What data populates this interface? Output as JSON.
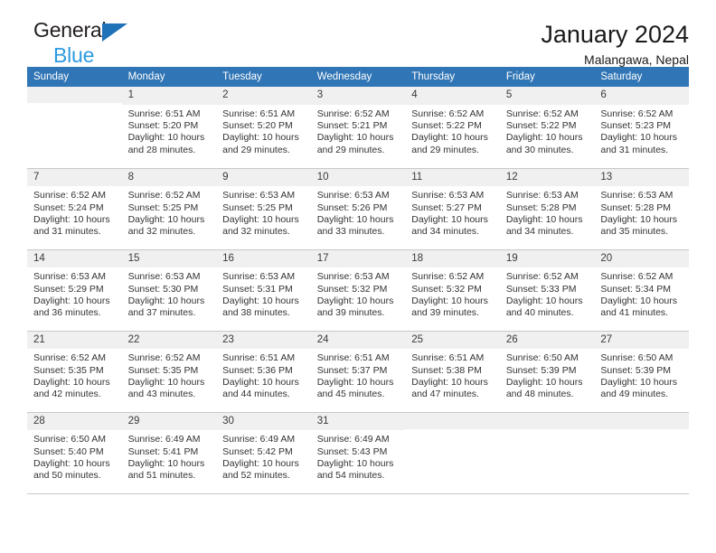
{
  "brand": {
    "name_top": "General",
    "name_bottom": "Blue",
    "triangle_color": "#1f71b8",
    "blue_color": "#2e9ae0"
  },
  "header": {
    "title": "January 2024",
    "location": "Malangawa, Nepal"
  },
  "theme": {
    "header_row_bg": "#3075b5",
    "daynum_bg": "#f0f0f0",
    "grid_line": "#c8c8c8",
    "text": "#333333"
  },
  "weekdays": [
    "Sunday",
    "Monday",
    "Tuesday",
    "Wednesday",
    "Thursday",
    "Friday",
    "Saturday"
  ],
  "weeks": [
    [
      {
        "day": "",
        "sunrise": "",
        "sunset": "",
        "daylight1": "",
        "daylight2": ""
      },
      {
        "day": "1",
        "sunrise": "Sunrise: 6:51 AM",
        "sunset": "Sunset: 5:20 PM",
        "daylight1": "Daylight: 10 hours",
        "daylight2": "and 28 minutes."
      },
      {
        "day": "2",
        "sunrise": "Sunrise: 6:51 AM",
        "sunset": "Sunset: 5:20 PM",
        "daylight1": "Daylight: 10 hours",
        "daylight2": "and 29 minutes."
      },
      {
        "day": "3",
        "sunrise": "Sunrise: 6:52 AM",
        "sunset": "Sunset: 5:21 PM",
        "daylight1": "Daylight: 10 hours",
        "daylight2": "and 29 minutes."
      },
      {
        "day": "4",
        "sunrise": "Sunrise: 6:52 AM",
        "sunset": "Sunset: 5:22 PM",
        "daylight1": "Daylight: 10 hours",
        "daylight2": "and 29 minutes."
      },
      {
        "day": "5",
        "sunrise": "Sunrise: 6:52 AM",
        "sunset": "Sunset: 5:22 PM",
        "daylight1": "Daylight: 10 hours",
        "daylight2": "and 30 minutes."
      },
      {
        "day": "6",
        "sunrise": "Sunrise: 6:52 AM",
        "sunset": "Sunset: 5:23 PM",
        "daylight1": "Daylight: 10 hours",
        "daylight2": "and 31 minutes."
      }
    ],
    [
      {
        "day": "7",
        "sunrise": "Sunrise: 6:52 AM",
        "sunset": "Sunset: 5:24 PM",
        "daylight1": "Daylight: 10 hours",
        "daylight2": "and 31 minutes."
      },
      {
        "day": "8",
        "sunrise": "Sunrise: 6:52 AM",
        "sunset": "Sunset: 5:25 PM",
        "daylight1": "Daylight: 10 hours",
        "daylight2": "and 32 minutes."
      },
      {
        "day": "9",
        "sunrise": "Sunrise: 6:53 AM",
        "sunset": "Sunset: 5:25 PM",
        "daylight1": "Daylight: 10 hours",
        "daylight2": "and 32 minutes."
      },
      {
        "day": "10",
        "sunrise": "Sunrise: 6:53 AM",
        "sunset": "Sunset: 5:26 PM",
        "daylight1": "Daylight: 10 hours",
        "daylight2": "and 33 minutes."
      },
      {
        "day": "11",
        "sunrise": "Sunrise: 6:53 AM",
        "sunset": "Sunset: 5:27 PM",
        "daylight1": "Daylight: 10 hours",
        "daylight2": "and 34 minutes."
      },
      {
        "day": "12",
        "sunrise": "Sunrise: 6:53 AM",
        "sunset": "Sunset: 5:28 PM",
        "daylight1": "Daylight: 10 hours",
        "daylight2": "and 34 minutes."
      },
      {
        "day": "13",
        "sunrise": "Sunrise: 6:53 AM",
        "sunset": "Sunset: 5:28 PM",
        "daylight1": "Daylight: 10 hours",
        "daylight2": "and 35 minutes."
      }
    ],
    [
      {
        "day": "14",
        "sunrise": "Sunrise: 6:53 AM",
        "sunset": "Sunset: 5:29 PM",
        "daylight1": "Daylight: 10 hours",
        "daylight2": "and 36 minutes."
      },
      {
        "day": "15",
        "sunrise": "Sunrise: 6:53 AM",
        "sunset": "Sunset: 5:30 PM",
        "daylight1": "Daylight: 10 hours",
        "daylight2": "and 37 minutes."
      },
      {
        "day": "16",
        "sunrise": "Sunrise: 6:53 AM",
        "sunset": "Sunset: 5:31 PM",
        "daylight1": "Daylight: 10 hours",
        "daylight2": "and 38 minutes."
      },
      {
        "day": "17",
        "sunrise": "Sunrise: 6:53 AM",
        "sunset": "Sunset: 5:32 PM",
        "daylight1": "Daylight: 10 hours",
        "daylight2": "and 39 minutes."
      },
      {
        "day": "18",
        "sunrise": "Sunrise: 6:52 AM",
        "sunset": "Sunset: 5:32 PM",
        "daylight1": "Daylight: 10 hours",
        "daylight2": "and 39 minutes."
      },
      {
        "day": "19",
        "sunrise": "Sunrise: 6:52 AM",
        "sunset": "Sunset: 5:33 PM",
        "daylight1": "Daylight: 10 hours",
        "daylight2": "and 40 minutes."
      },
      {
        "day": "20",
        "sunrise": "Sunrise: 6:52 AM",
        "sunset": "Sunset: 5:34 PM",
        "daylight1": "Daylight: 10 hours",
        "daylight2": "and 41 minutes."
      }
    ],
    [
      {
        "day": "21",
        "sunrise": "Sunrise: 6:52 AM",
        "sunset": "Sunset: 5:35 PM",
        "daylight1": "Daylight: 10 hours",
        "daylight2": "and 42 minutes."
      },
      {
        "day": "22",
        "sunrise": "Sunrise: 6:52 AM",
        "sunset": "Sunset: 5:35 PM",
        "daylight1": "Daylight: 10 hours",
        "daylight2": "and 43 minutes."
      },
      {
        "day": "23",
        "sunrise": "Sunrise: 6:51 AM",
        "sunset": "Sunset: 5:36 PM",
        "daylight1": "Daylight: 10 hours",
        "daylight2": "and 44 minutes."
      },
      {
        "day": "24",
        "sunrise": "Sunrise: 6:51 AM",
        "sunset": "Sunset: 5:37 PM",
        "daylight1": "Daylight: 10 hours",
        "daylight2": "and 45 minutes."
      },
      {
        "day": "25",
        "sunrise": "Sunrise: 6:51 AM",
        "sunset": "Sunset: 5:38 PM",
        "daylight1": "Daylight: 10 hours",
        "daylight2": "and 47 minutes."
      },
      {
        "day": "26",
        "sunrise": "Sunrise: 6:50 AM",
        "sunset": "Sunset: 5:39 PM",
        "daylight1": "Daylight: 10 hours",
        "daylight2": "and 48 minutes."
      },
      {
        "day": "27",
        "sunrise": "Sunrise: 6:50 AM",
        "sunset": "Sunset: 5:39 PM",
        "daylight1": "Daylight: 10 hours",
        "daylight2": "and 49 minutes."
      }
    ],
    [
      {
        "day": "28",
        "sunrise": "Sunrise: 6:50 AM",
        "sunset": "Sunset: 5:40 PM",
        "daylight1": "Daylight: 10 hours",
        "daylight2": "and 50 minutes."
      },
      {
        "day": "29",
        "sunrise": "Sunrise: 6:49 AM",
        "sunset": "Sunset: 5:41 PM",
        "daylight1": "Daylight: 10 hours",
        "daylight2": "and 51 minutes."
      },
      {
        "day": "30",
        "sunrise": "Sunrise: 6:49 AM",
        "sunset": "Sunset: 5:42 PM",
        "daylight1": "Daylight: 10 hours",
        "daylight2": "and 52 minutes."
      },
      {
        "day": "31",
        "sunrise": "Sunrise: 6:49 AM",
        "sunset": "Sunset: 5:43 PM",
        "daylight1": "Daylight: 10 hours",
        "daylight2": "and 54 minutes."
      },
      {
        "day": "",
        "sunrise": "",
        "sunset": "",
        "daylight1": "",
        "daylight2": ""
      },
      {
        "day": "",
        "sunrise": "",
        "sunset": "",
        "daylight1": "",
        "daylight2": ""
      },
      {
        "day": "",
        "sunrise": "",
        "sunset": "",
        "daylight1": "",
        "daylight2": ""
      }
    ]
  ]
}
